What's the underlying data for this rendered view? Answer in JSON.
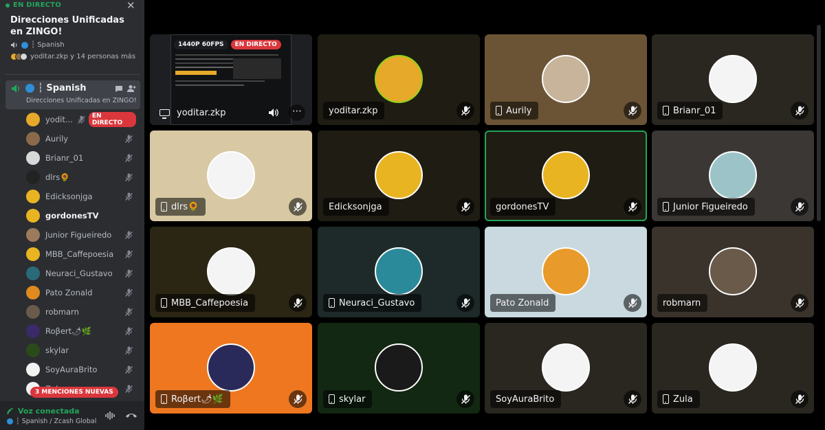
{
  "sidebar": {
    "live_label": "EN DIRECTO",
    "stage_title": "Direcciones Unificadas en ZINGO!",
    "stage_channel": "┆ Spanish",
    "stage_people": "yoditar.zkp y 14 personas más",
    "channel": {
      "name": "┆ Spanish",
      "description": "Direcciones Unificadas en ZINGO!"
    },
    "members": [
      {
        "name": "yodit...",
        "color": "#e6a92a",
        "live": "EN DIRECTO"
      },
      {
        "name": "Aurily",
        "color": "#8a6a4a"
      },
      {
        "name": "Brianr_01",
        "color": "#d8d8d8"
      },
      {
        "name": "dlrs🌻",
        "color": "#222222"
      },
      {
        "name": "Edicksonjga",
        "color": "#e8b422"
      },
      {
        "name": "gordonesTV",
        "color": "#e8b422",
        "active": true
      },
      {
        "name": "Junior Figueiredo",
        "color": "#9c7a5c"
      },
      {
        "name": "MBB_Caffepoesia",
        "color": "#e8b422"
      },
      {
        "name": "Neuraci_Gustavo",
        "color": "#2a6a7a"
      },
      {
        "name": "Pato Zonald",
        "color": "#e08a20"
      },
      {
        "name": "robmarn",
        "color": "#6a5a4a"
      },
      {
        "name": "Roβert🌶🌿",
        "color": "#3a2a6a"
      },
      {
        "name": "skylar",
        "color": "#2a4a1a"
      },
      {
        "name": "SoyAuraBrito",
        "color": "#f2f2f2"
      },
      {
        "name": "Zula",
        "color": "#f2f2f2"
      }
    ],
    "mentions_badge": "3 MENCIONES NUEVAS",
    "voice_status": "Voz conectada",
    "voice_channel": "┆ Spanish / Zcash Global"
  },
  "stream": {
    "name": "yoditar.zkp",
    "resolution": "1440P 60FPS",
    "live": "EN DIRECTO"
  },
  "tiles": [
    {
      "name": "yoditar.zkp",
      "bg": "#1f1c13",
      "ring": "#8ed41a",
      "av": "#e6a92a",
      "device": "none"
    },
    {
      "name": "Aurily",
      "bg": "#6b5436",
      "av": "#c7b49a",
      "device": "phone"
    },
    {
      "name": "Brianr_01",
      "bg": "#2a2721",
      "av": "#f4f4f4",
      "device": "phone"
    },
    {
      "name": "dlrs🌻",
      "bg": "#d8c9a4",
      "av": "#f4f4f4",
      "device": "phone"
    },
    {
      "name": "Edicksonjga",
      "bg": "#1f1c13",
      "av": "#e8b422",
      "device": "none"
    },
    {
      "name": "gordonesTV",
      "bg": "#1f1c13",
      "av": "#e8b422",
      "device": "none",
      "speaking": true
    },
    {
      "name": "Junior Figueiredo",
      "bg": "#3a3734",
      "av": "#9cc4c8",
      "device": "phone"
    },
    {
      "name": "MBB_Caffepoesia",
      "bg": "#2b2514",
      "av": "#f4f4f4",
      "device": "phone"
    },
    {
      "name": "Neuraci_Gustavo",
      "bg": "#1e2a29",
      "av": "#2b8a9a",
      "device": "phone"
    },
    {
      "name": "Pato Zonald",
      "bg": "#c9d9df",
      "av": "#e89a2a",
      "device": "none"
    },
    {
      "name": "robmarn",
      "bg": "#3a332c",
      "av": "#6a5a4a",
      "device": "none"
    },
    {
      "name": "Roβert🌶🌿",
      "bg": "#ee7720",
      "av": "#2a2a5a",
      "device": "phone"
    },
    {
      "name": "skylar",
      "bg": "#132812",
      "av": "#1a1a1a",
      "device": "phone"
    },
    {
      "name": "SoyAuraBrito",
      "bg": "#2a2721",
      "av": "#f4f4f4",
      "device": "none"
    },
    {
      "name": "Zula",
      "bg": "#2a2721",
      "av": "#f4f4f4",
      "device": "phone"
    }
  ],
  "colors": {
    "accent_green": "#23a55a",
    "live_red": "#da373c",
    "sidebar_bg": "#2b2d31"
  }
}
